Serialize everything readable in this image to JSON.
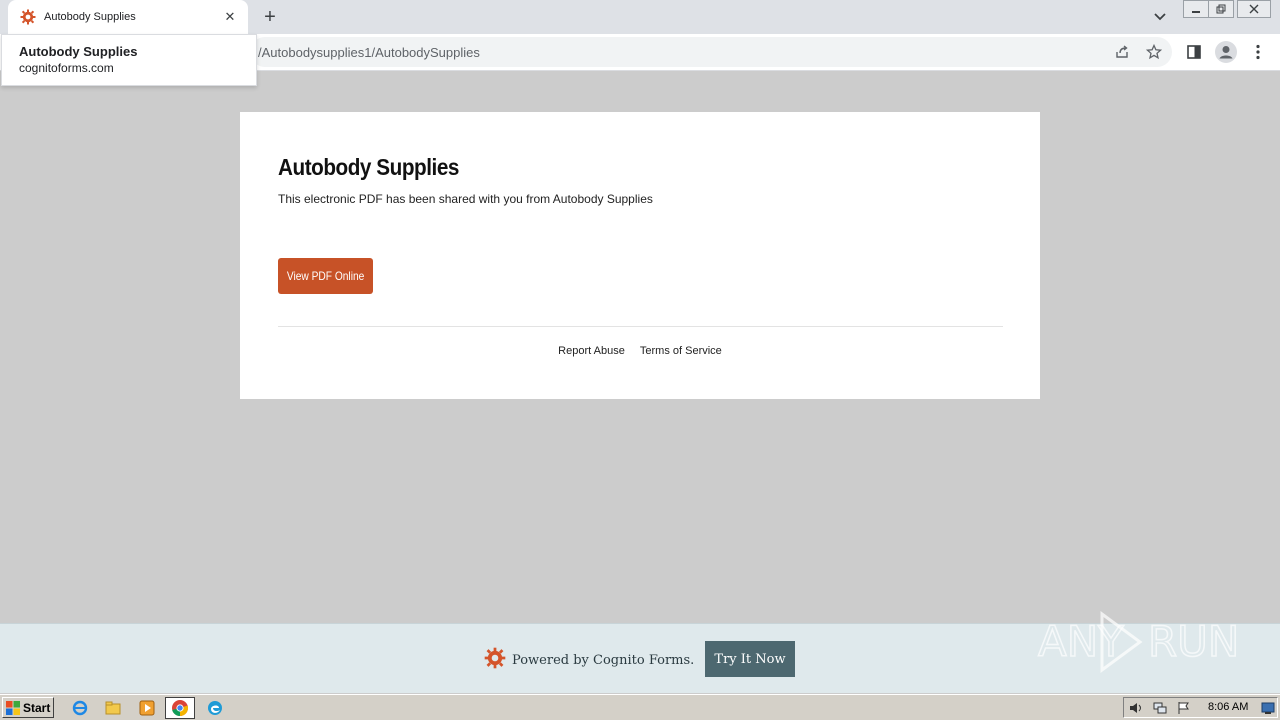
{
  "browser": {
    "tab_title": "Autobody Supplies",
    "url_text": "/Autobodysupplies1/AutobodySupplies",
    "hover_card": {
      "title": "Autobody Supplies",
      "domain": "cognitoforms.com"
    }
  },
  "card": {
    "heading": "Autobody Supplies",
    "description": "This electronic PDF has been shared with you from Autobody Supplies",
    "view_pdf_label": "View PDF Online",
    "links": [
      "Report Abuse",
      "Terms of Service"
    ]
  },
  "powered_bar": {
    "text": "Powered by Cognito Forms.",
    "try_label": "Try It Now"
  },
  "watermark": {
    "text": "ANY RUN"
  },
  "taskbar": {
    "start_label": "Start",
    "clock": "8:06 AM"
  },
  "colors": {
    "accent": "#c75227",
    "try_button": "#4d6870",
    "page_bg": "#cccccc"
  },
  "icons": {
    "tab_favicon": "cognito-gear-icon",
    "tab_close": "close-icon",
    "new_tab": "plus-icon",
    "tab_search": "chevron-down-icon",
    "share": "share-icon",
    "bookmark": "star-icon",
    "side_panel": "side-panel-icon",
    "profile": "profile-icon",
    "menu": "kebab-menu-icon"
  }
}
